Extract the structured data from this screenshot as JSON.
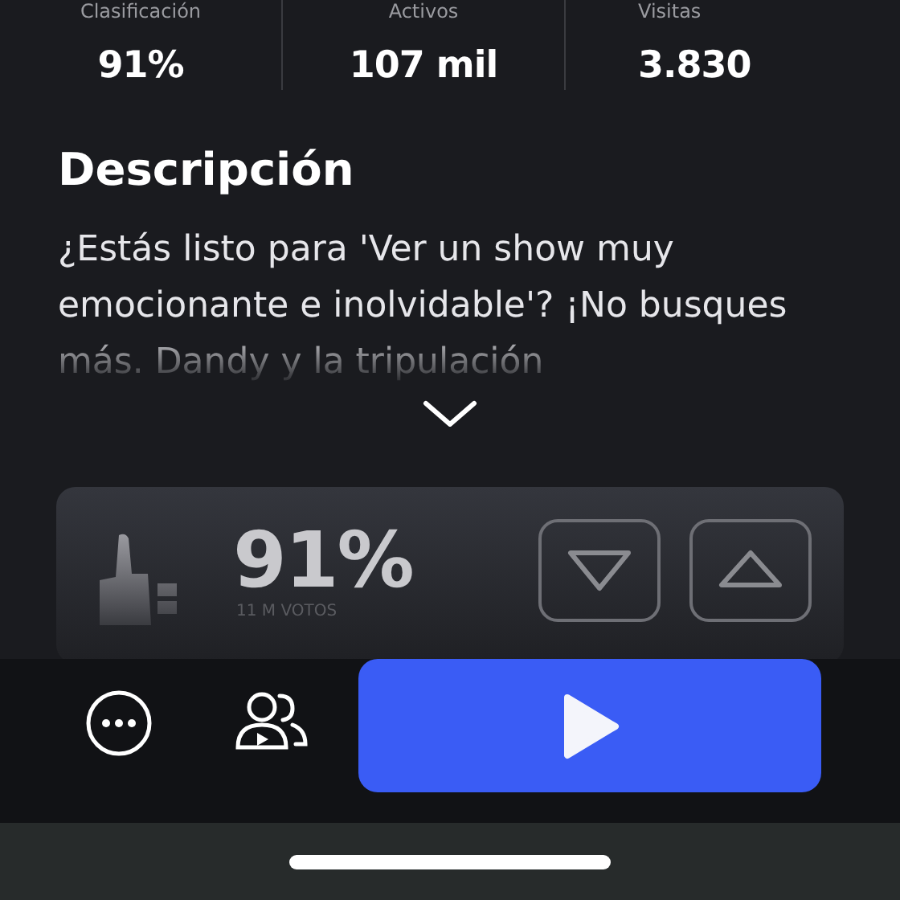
{
  "stats": [
    {
      "label": "Clasificación",
      "value": "91%"
    },
    {
      "label": "Activos",
      "value": "107 mil"
    },
    {
      "label": "Visitas",
      "value": "3.830"
    }
  ],
  "description": {
    "title": "Descripción",
    "text": "¿Estás listo para 'Ver un show muy emocionante e inolvidable'? ¡No busques más. Dandy y la tripulación"
  },
  "rating": {
    "percent": "91%",
    "votes": "11 M VOTOS"
  }
}
